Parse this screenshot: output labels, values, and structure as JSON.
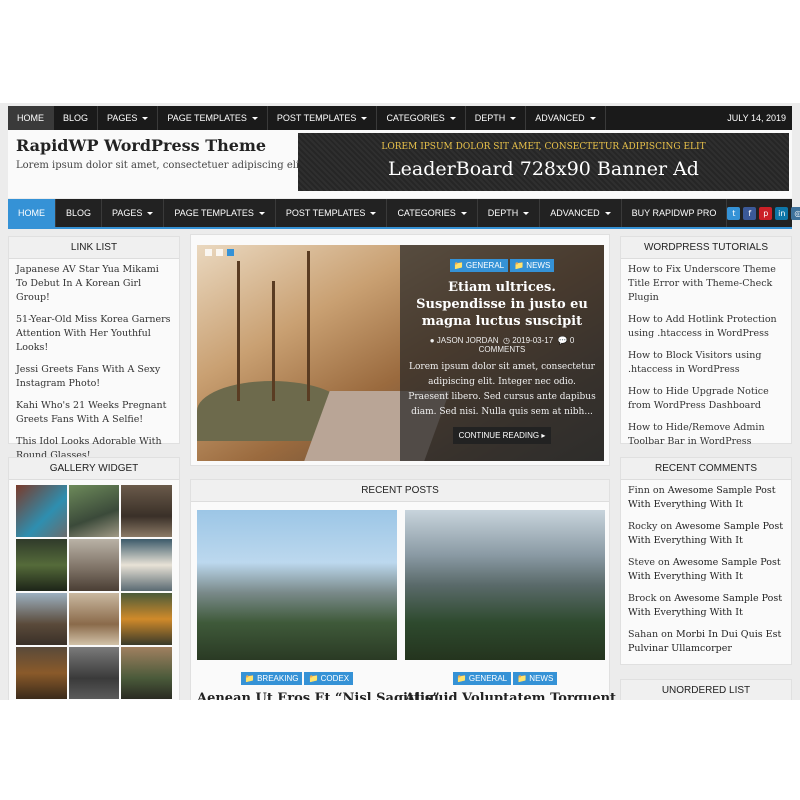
{
  "topnav": {
    "items": [
      "HOME",
      "BLOG",
      "PAGES",
      "PAGE TEMPLATES",
      "POST TEMPLATES",
      "CATEGORIES",
      "DEPTH",
      "ADVANCED"
    ],
    "date": "JULY 14, 2019"
  },
  "header": {
    "title": "RapidWP WordPress Theme",
    "description": "Lorem ipsum dolor sit amet, consectetuer adipiscing elit.",
    "banner_sub": "LOREM IPSUM DOLOR SIT AMET, CONSECTETUR ADIPISCING ELIT",
    "banner_main": "LeaderBoard 728x90 Banner Ad"
  },
  "mainnav": {
    "items": [
      "HOME",
      "BLOG",
      "PAGES",
      "PAGE TEMPLATES",
      "POST TEMPLATES",
      "CATEGORIES",
      "DEPTH",
      "ADVANCED",
      "BUY RAPIDWP PRO"
    ]
  },
  "social_icons": [
    {
      "name": "twitter-icon",
      "glyph": "t",
      "color": "#3592d6"
    },
    {
      "name": "facebook-icon",
      "glyph": "f",
      "color": "#3b5998"
    },
    {
      "name": "pinterest-icon",
      "glyph": "p",
      "color": "#cb2027"
    },
    {
      "name": "linkedin-icon",
      "glyph": "in",
      "color": "#0e76a8"
    },
    {
      "name": "instagram-icon",
      "glyph": "◎",
      "color": "#3f729b"
    },
    {
      "name": "youtube-icon",
      "glyph": "▶",
      "color": "#cd201f"
    },
    {
      "name": "email-icon",
      "glyph": "✉",
      "color": "#3592d6"
    },
    {
      "name": "rss-icon",
      "glyph": "◉",
      "color": "#f2a01c"
    },
    {
      "name": "search-icon",
      "glyph": "⌕",
      "color": "#555555"
    },
    {
      "name": "login-icon",
      "glyph": "➜",
      "color": "#2e9b41"
    }
  ],
  "link_list": {
    "title": "LINK LIST",
    "items": [
      "Japanese AV Star Yua Mikami To Debut In A Korean Girl Group!",
      "51-Year-Old Miss Korea Garners Attention With Her Youthful Looks!",
      "Jessi Greets Fans With A Sexy Instagram Photo!",
      "Kahi Who's 21 Weeks Pregnant Greets Fans With A Selfie!",
      "This Idol Looks Adorable With Round Glasses!"
    ]
  },
  "gallery_widget": {
    "title": "GALLERY WIDGET"
  },
  "featured": {
    "tags": [
      "GENERAL",
      "NEWS"
    ],
    "title": "Etiam ultrices. Suspendisse in justo eu magna luctus suscipit",
    "author": "JASON JORDAN",
    "date": "2019-03-17",
    "comments": "0 COMMENTS",
    "excerpt": "Lorem ipsum dolor sit amet, consectetur adipiscing elit. Integer nec odio. Praesent libero. Sed cursus ante dapibus diam. Sed nisi. Nulla quis sem at nibh...",
    "button": "CONTINUE READING"
  },
  "recent_posts": {
    "title": "RECENT POSTS",
    "posts": [
      {
        "tags": [
          "BREAKING",
          "CODEX"
        ],
        "title": "Aenean Ut Eros Et “Nisl Sagittis”"
      },
      {
        "tags": [
          "GENERAL",
          "NEWS"
        ],
        "title": "Aliquid Voluptatem Torquent"
      }
    ]
  },
  "wp_tutorials": {
    "title": "WORDPRESS TUTORIALS",
    "items": [
      "How to Fix Underscore Theme Title Error with Theme-Check Plugin",
      "How to Add Hotlink Protection using .htaccess in WordPress",
      "How to Block Visitors using .htaccess in WordPress",
      "How to Hide Upgrade Notice from WordPress Dashboard",
      "How to Hide/Remove Admin Toolbar Bar in WordPress"
    ]
  },
  "recent_comments": {
    "title": "RECENT COMMENTS",
    "items": [
      {
        "author": "Finn",
        "on": "on",
        "post": "Awesome Sample Post With Everything With It"
      },
      {
        "author": "Rocky",
        "on": "on",
        "post": "Awesome Sample Post With Everything With It"
      },
      {
        "author": "Steve",
        "on": "on",
        "post": "Awesome Sample Post With Everything With It"
      },
      {
        "author": "Brock",
        "on": "on",
        "post": "Awesome Sample Post With Everything With It"
      },
      {
        "author": "Sahan",
        "on": "on",
        "post": "Morbi In Dui Quis Est Pulvinar Ullamcorper"
      }
    ]
  },
  "unordered_list": {
    "title": "UNORDERED LIST"
  },
  "colors": {
    "accent": "#3592d6",
    "nav_bg": "#222222",
    "top_bg": "#1a1a1a"
  }
}
